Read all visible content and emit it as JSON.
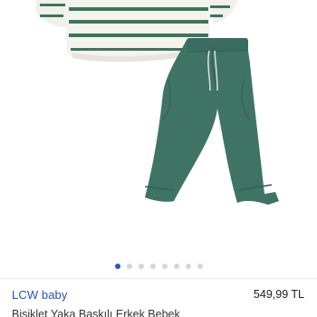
{
  "product": {
    "brand": "LCW baby",
    "price": "549,99 TL",
    "name": "Bisiklet Yaka Baskılı Erkek Bebek",
    "image_icon": "product-photo",
    "colors": {
      "accent": "#2557c8",
      "brand_text": "#1f56c4",
      "pants": "#3f7465",
      "stripe": "#3b7560"
    }
  },
  "gallery": {
    "image_count": 8,
    "active_index": 0
  }
}
